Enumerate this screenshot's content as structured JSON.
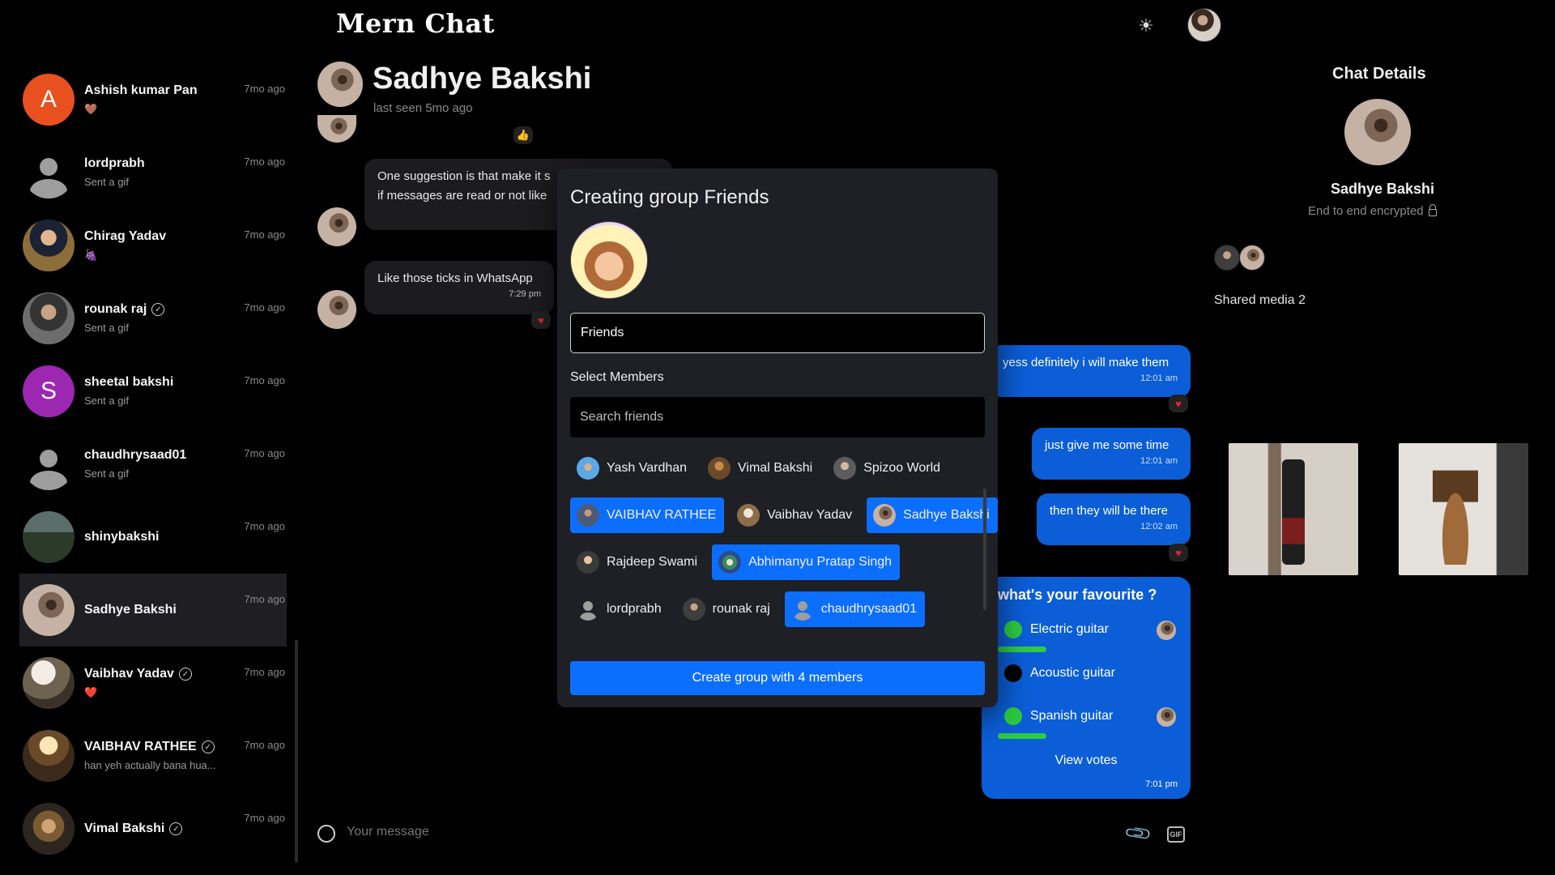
{
  "app": {
    "title": "Mern Chat"
  },
  "sidebar": {
    "conversations": [
      {
        "name": "Ashish kumar Pan",
        "initial": "A",
        "preview": "🤎",
        "time": "7mo ago",
        "verified": false
      },
      {
        "name": "lordprabh",
        "preview": "Sent a gif",
        "time": "7mo ago",
        "verified": false
      },
      {
        "name": "Chirag Yadav",
        "preview": "🍇",
        "time": "7mo ago",
        "verified": false
      },
      {
        "name": "rounak raj",
        "preview": "Sent a gif",
        "time": "7mo ago",
        "verified": true
      },
      {
        "name": "sheetal bakshi",
        "initial": "S",
        "preview": "Sent a gif",
        "time": "7mo ago",
        "verified": false
      },
      {
        "name": "chaudhrysaad01",
        "preview": "Sent a gif",
        "time": "7mo ago",
        "verified": false
      },
      {
        "name": "shinybakshi",
        "preview": "",
        "time": "7mo ago",
        "verified": false
      },
      {
        "name": "Sadhye Bakshi",
        "preview": "",
        "time": "7mo ago",
        "verified": false
      },
      {
        "name": "Vaibhav Yadav",
        "preview": "❤️",
        "time": "7mo ago",
        "verified": true
      },
      {
        "name": "VAIBHAV RATHEE",
        "preview": "han yeh actually bana hua...",
        "time": "7mo ago",
        "verified": true
      },
      {
        "name": "Vimal Bakshi",
        "preview": "",
        "time": "7mo ago",
        "verified": true
      }
    ]
  },
  "chat": {
    "name": "Sadhye Bakshi",
    "status": "last seen 5mo ago",
    "messages": {
      "m1_line1": "One suggestion is that make it s",
      "m1_line2": "if messages are read or not like",
      "m2": "Like those ticks in WhatsApp",
      "m2_time": "7:29 pm",
      "m3": "yess definitely i will make them",
      "m3_time": "12:01 am",
      "m4": "just give me some time",
      "m4_time": "12:01 am",
      "m5": "then they will be there",
      "m5_time": "12:02 am"
    },
    "reactions": {
      "thumb": "👍",
      "heart": "♥"
    },
    "poll": {
      "question": "what's your favourite ?",
      "options": [
        {
          "label": "Electric guitar",
          "vote_share": 0.5,
          "color": "#2ecc40"
        },
        {
          "label": "Acoustic guitar",
          "vote_share": 0,
          "color": "#000000"
        },
        {
          "label": "Spanish guitar",
          "vote_share": 0.5,
          "color": "#2ecc40"
        }
      ],
      "view_votes": "View votes",
      "time": "7:01 pm"
    },
    "composer": {
      "placeholder": "Your message",
      "gif_label": "GIF"
    }
  },
  "details": {
    "title": "Chat Details",
    "name": "Sadhye Bakshi",
    "encryption": "End to end encrypted",
    "shared_media": "Shared media 2"
  },
  "modal": {
    "title": "Creating group Friends",
    "group_name": "Friends",
    "select_label": "Select Members",
    "search_placeholder": "Search friends",
    "rows": [
      [
        {
          "name": "Yash Vardhan",
          "selected": false
        },
        {
          "name": "Vimal Bakshi",
          "selected": false
        },
        {
          "name": "Spizoo World",
          "selected": false
        }
      ],
      [
        {
          "name": "VAIBHAV RATHEE",
          "selected": true
        },
        {
          "name": "Vaibhav Yadav",
          "selected": false
        },
        {
          "name": "Sadhye Bakshi",
          "selected": true
        }
      ],
      [
        {
          "name": "Rajdeep Swami",
          "selected": false
        },
        {
          "name": "Abhimanyu Pratap Singh",
          "selected": true
        }
      ],
      [
        {
          "name": "lordprabh",
          "selected": false
        },
        {
          "name": "rounak raj",
          "selected": false
        },
        {
          "name": "chaudhrysaad01",
          "selected": true
        }
      ]
    ],
    "create_button": "Create group with 4 members"
  },
  "colors": {
    "accent": "#0b6efd",
    "bubble_out": "#0b5ed7",
    "bubble_in": "#1c1c1f",
    "background": "#000000",
    "modal": "#1f1f26",
    "heart": "#e0243a"
  }
}
